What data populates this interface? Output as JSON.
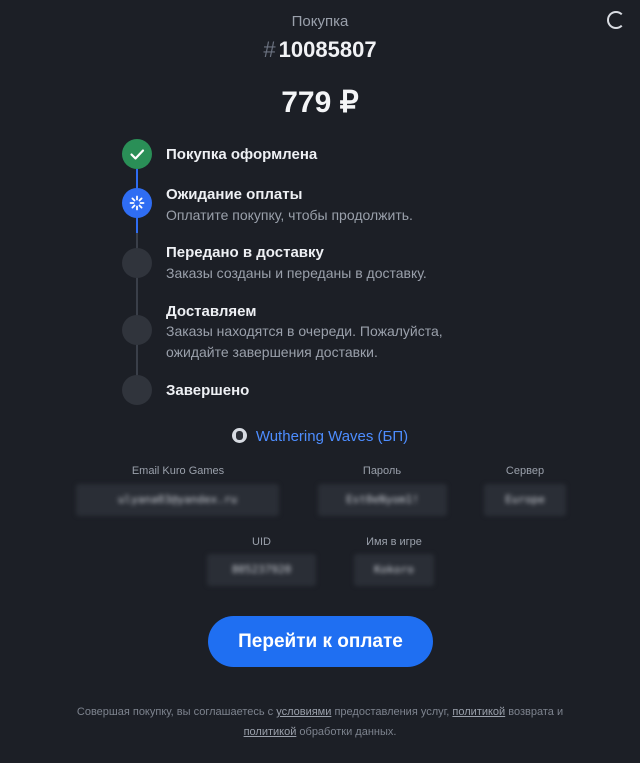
{
  "header": {
    "label": "Покупка",
    "hash": "#",
    "order_number": "10085807"
  },
  "price": "779 ₽",
  "steps": [
    {
      "title": "Покупка оформлена",
      "description": "",
      "status": "done"
    },
    {
      "title": "Ожидание оплаты",
      "description": "Оплатите покупку, чтобы продолжить.",
      "status": "active"
    },
    {
      "title": "Передано в доставку",
      "description": "Заказы созданы и переданы в доставку.",
      "status": "pending"
    },
    {
      "title": "Доставляем",
      "description": "Заказы находятся в очереди. Пожалуйста, ожидайте завершения доставки.",
      "status": "pending"
    },
    {
      "title": "Завершено",
      "description": "",
      "status": "pending"
    }
  ],
  "game": {
    "name": "Wuthering Waves (БП)",
    "icon": "game-icon"
  },
  "fields": {
    "email": {
      "label": "Email Kuro Games",
      "value": "ulyana03@yandex.ru"
    },
    "password": {
      "label": "Пароль",
      "value": "Est0eNyom1!"
    },
    "server": {
      "label": "Сервер",
      "value": "Europe"
    },
    "uid": {
      "label": "UID",
      "value": "805237920"
    },
    "nickname": {
      "label": "Имя в игре",
      "value": "Kokoro"
    }
  },
  "pay_button": "Перейти к оплате",
  "footer": {
    "text_1": "Совершая покупку, вы соглашаетесь с ",
    "link_terms": "условиями",
    "text_2": " предоставления услуг, ",
    "link_refund": "политикой",
    "text_3": " возврата и",
    "link_privacy": "политикой",
    "text_4": " обработки данных."
  },
  "colors": {
    "background": "#1c1f26",
    "accent": "#1f6ff2",
    "success": "#2a8f57",
    "link": "#4d8dff"
  }
}
